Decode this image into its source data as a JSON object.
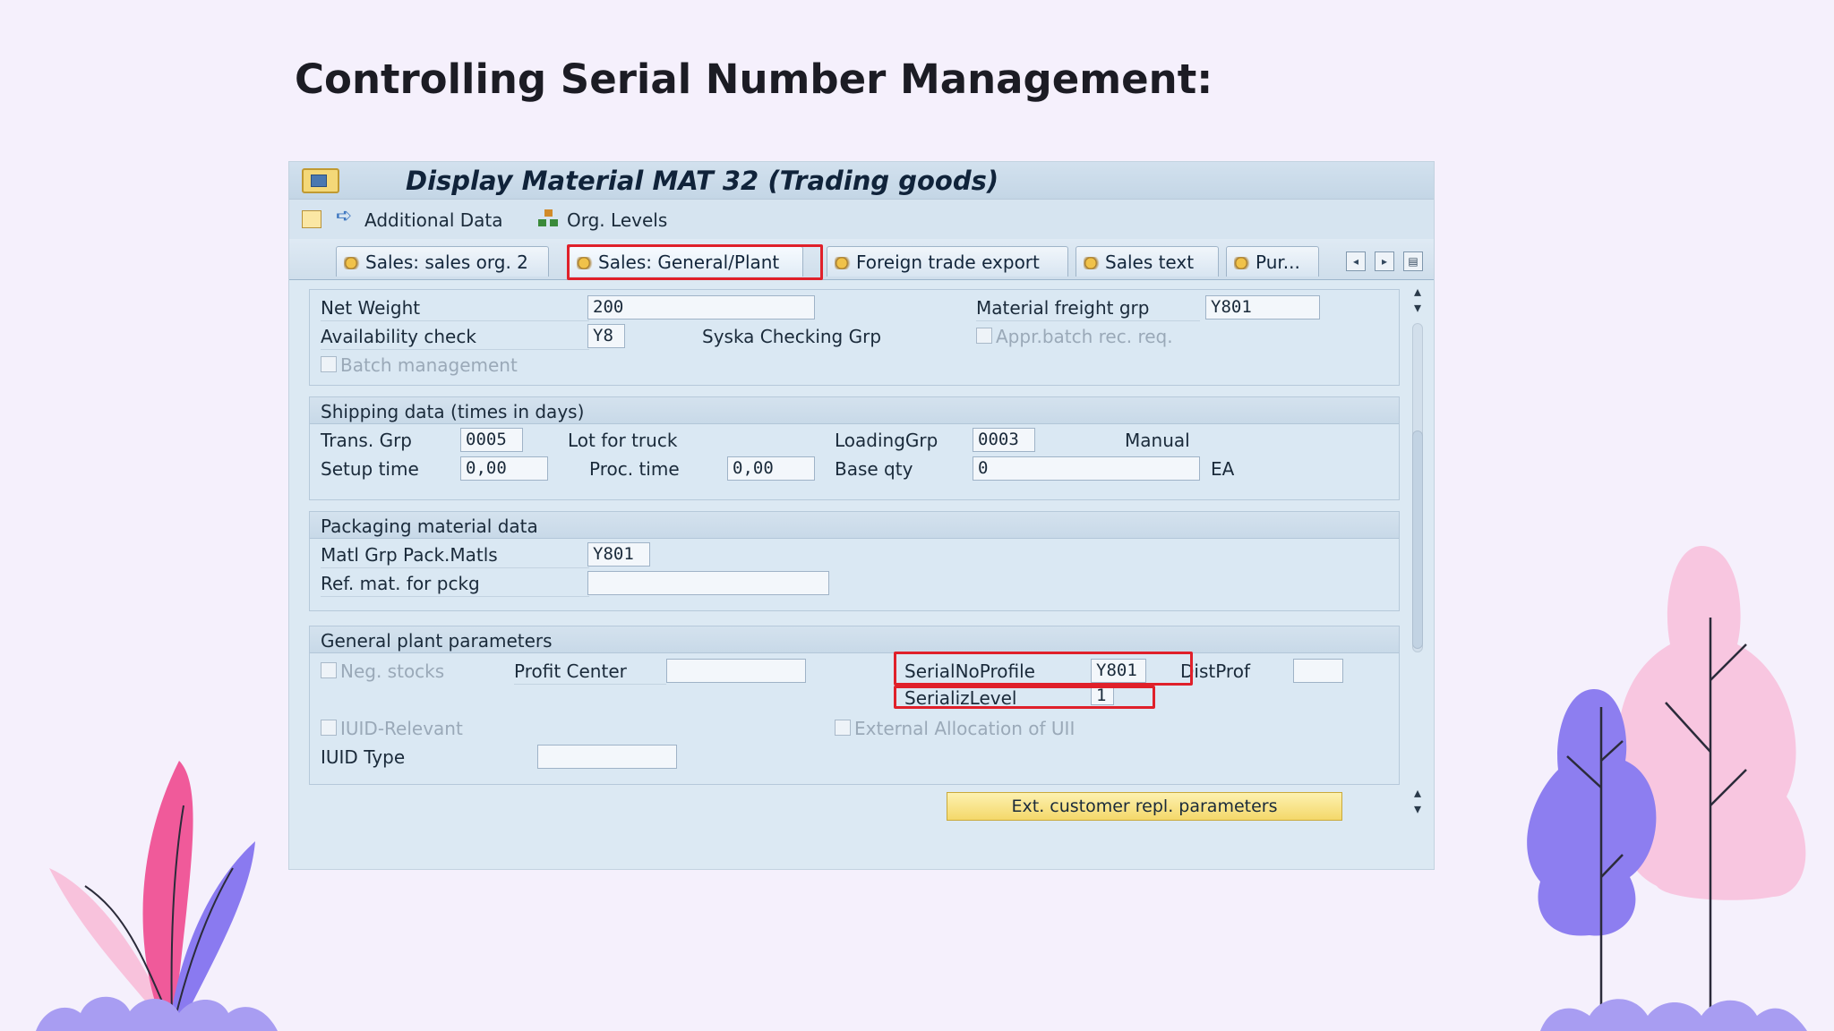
{
  "slide": {
    "title": "Controlling Serial Number Management:"
  },
  "window": {
    "title": "Display Material MAT 32 (Trading goods)"
  },
  "toolbar": {
    "additional_data": "Additional Data",
    "org_levels": "Org. Levels"
  },
  "tabs": [
    {
      "label": "Sales: sales org. 2"
    },
    {
      "label": "Sales: General/Plant"
    },
    {
      "label": "Foreign trade export"
    },
    {
      "label": "Sales text"
    },
    {
      "label": "Pur..."
    }
  ],
  "general": {
    "net_weight_label": "Net Weight",
    "net_weight_value": "200",
    "material_freight_grp_label": "Material freight grp",
    "material_freight_grp_value": "Y801",
    "availability_check_label": "Availability check",
    "availability_check_value": "Y8",
    "availability_check_text": "Syska Checking Grp",
    "appr_batch_label": "Appr.batch rec. req.",
    "batch_management_label": "Batch management"
  },
  "shipping": {
    "header": "Shipping data (times in days)",
    "trans_grp_label": "Trans. Grp",
    "trans_grp_value": "0005",
    "trans_grp_text": "Lot for truck",
    "loading_grp_label": "LoadingGrp",
    "loading_grp_value": "0003",
    "loading_grp_text": "Manual",
    "setup_time_label": "Setup time",
    "setup_time_value": "0,00",
    "proc_time_label": "Proc. time",
    "proc_time_value": "0,00",
    "base_qty_label": "Base qty",
    "base_qty_value": "0",
    "base_qty_unit": "EA"
  },
  "packaging": {
    "header": "Packaging material data",
    "matl_grp_label": "Matl Grp Pack.Matls",
    "matl_grp_value": "Y801",
    "ref_mat_label": "Ref. mat. for pckg",
    "ref_mat_value": ""
  },
  "plant_params": {
    "header": "General plant parameters",
    "neg_stocks_label": "Neg. stocks",
    "profit_center_label": "Profit Center",
    "profit_center_value": "",
    "serial_no_profile_label": "SerialNoProfile",
    "serial_no_profile_value": "Y801",
    "dist_prof_label": "DistProf",
    "dist_prof_value": "",
    "serializ_level_label": "SerializLevel",
    "serializ_level_value": "1",
    "iuid_relevant_label": "IUID-Relevant",
    "external_allocation_label": "External Allocation of UII",
    "iuid_type_label": "IUID Type",
    "iuid_type_value": ""
  },
  "buttons": {
    "ext_customer": "Ext. customer repl. parameters"
  },
  "colors": {
    "highlight": "#e0202a",
    "background": "#f5f0fc"
  }
}
